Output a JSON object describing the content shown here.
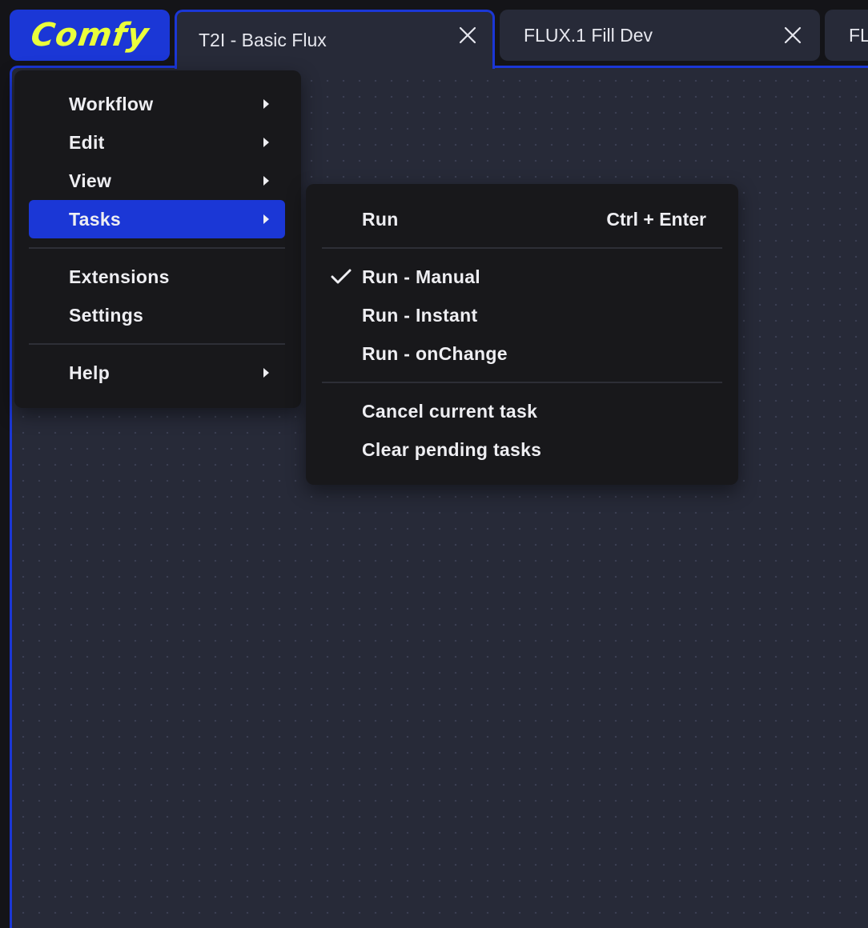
{
  "logo": {
    "text": "Comfy",
    "color": "#eaff3c",
    "bg": "#1b37d6"
  },
  "tabs": [
    {
      "label": "T2I - Basic Flux",
      "active": true
    },
    {
      "label": "FLUX.1 Fill Dev",
      "active": false
    },
    {
      "label": "FL",
      "active": false
    }
  ],
  "main_menu": {
    "items": [
      {
        "label": "Workflow",
        "submenu": true
      },
      {
        "label": "Edit",
        "submenu": true
      },
      {
        "label": "View",
        "submenu": true
      },
      {
        "label": "Tasks",
        "submenu": true,
        "active": true
      },
      {
        "label": "Extensions",
        "submenu": false
      },
      {
        "label": "Settings",
        "submenu": false
      },
      {
        "label": "Help",
        "submenu": true
      }
    ]
  },
  "tasks_menu": {
    "run": {
      "label": "Run",
      "shortcut": "Ctrl + Enter"
    },
    "modes": [
      {
        "label": "Run - Manual",
        "checked": true
      },
      {
        "label": "Run - Instant",
        "checked": false
      },
      {
        "label": "Run - onChange",
        "checked": false
      }
    ],
    "actions": [
      {
        "label": "Cancel current task"
      },
      {
        "label": "Clear pending tasks"
      }
    ]
  },
  "colors": {
    "accent": "#1b37d6",
    "canvas": "#272a38",
    "menu_bg": "#18181b"
  }
}
